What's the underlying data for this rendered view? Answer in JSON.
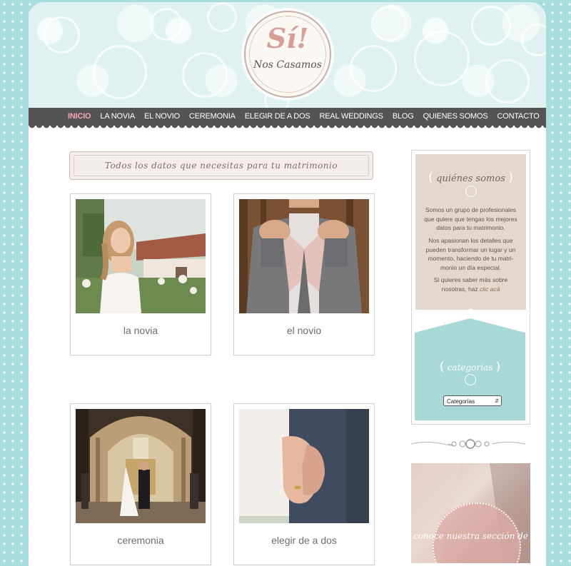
{
  "logo": {
    "main": "Sí!",
    "sub": "Nos Casamos"
  },
  "nav": {
    "items": [
      {
        "label": "INICIO"
      },
      {
        "label": "LA NOVIA"
      },
      {
        "label": "EL NOVIO"
      },
      {
        "label": "CEREMONIA"
      },
      {
        "label": "ELEGIR DE A DOS"
      },
      {
        "label": "REAL WEDDINGS"
      },
      {
        "label": "BLOG"
      },
      {
        "label": "QUIENES SOMOS"
      },
      {
        "label": "CONTACTO"
      }
    ],
    "active_index": 0
  },
  "banner": {
    "text": "Todos los datos que necesitas para tu matrimonio"
  },
  "cards": [
    {
      "label": "la novia"
    },
    {
      "label": "el novio"
    },
    {
      "label": "ceremonia"
    },
    {
      "label": "elegir de a dos"
    }
  ],
  "sidebar": {
    "about": {
      "title": "quiénes somos",
      "p1": "Somos un grupo de profesionales que quiere que tengas los mejores datos para tu matrimonio.",
      "p2": "Nos apasionan los detalles que pueden transformar un lugar y un momento, haciendo de tu matri-monio un día especial.",
      "p3_prefix": "Si quieres saber más sobre nosotras, haz",
      "p3_link": "clic acá"
    },
    "categories": {
      "title": "categorías",
      "select_value": "Categorías"
    },
    "promo": {
      "text": "conoce nuestra sección de"
    }
  },
  "colors": {
    "accent": "#f4a6b0",
    "nav_bg": "#545454",
    "background": "#a9dcdc"
  }
}
